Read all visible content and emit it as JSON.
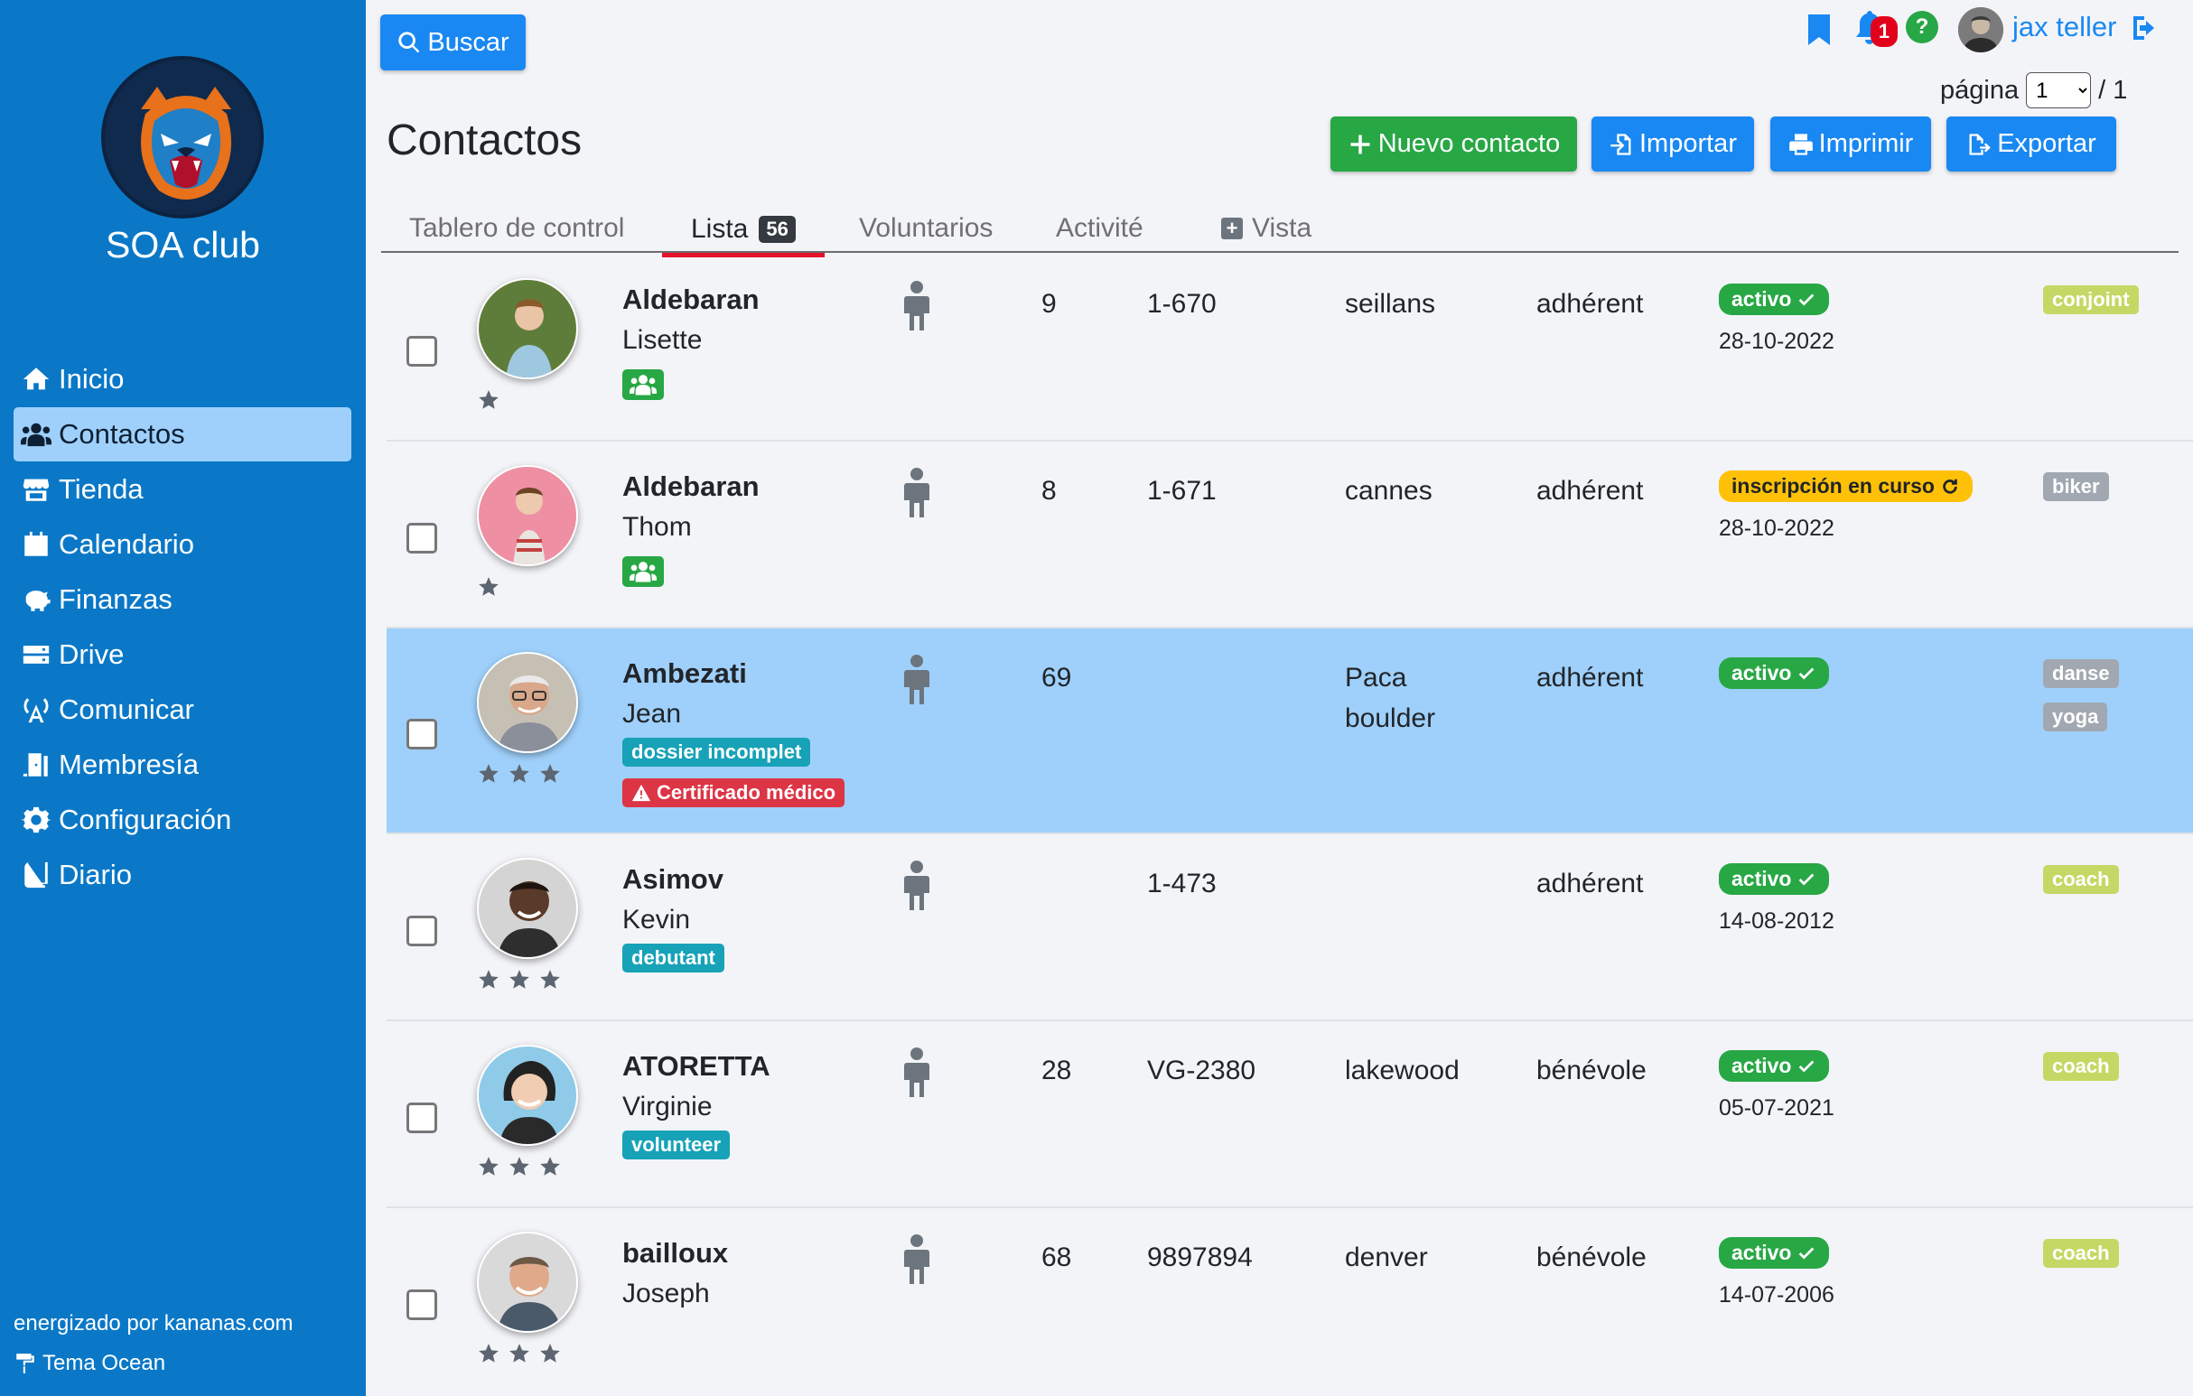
{
  "sidebar": {
    "club_name": "SOA club",
    "nav": [
      {
        "label": "Inicio",
        "icon": "home-icon"
      },
      {
        "label": "Contactos",
        "icon": "users-icon"
      },
      {
        "label": "Tienda",
        "icon": "store-icon"
      },
      {
        "label": "Calendario",
        "icon": "calendar-icon"
      },
      {
        "label": "Finanzas",
        "icon": "piggy-bank-icon"
      },
      {
        "label": "Drive",
        "icon": "drive-icon"
      },
      {
        "label": "Comunicar",
        "icon": "broadcast-icon"
      },
      {
        "label": "Membresía",
        "icon": "door-icon"
      },
      {
        "label": "Configuración",
        "icon": "gear-icon"
      },
      {
        "label": "Diario",
        "icon": "book-icon"
      }
    ],
    "powered_by": "energizado por kananas.com",
    "theme": "Tema Ocean"
  },
  "header": {
    "search_label": "Buscar",
    "notification_count": "1",
    "help_label": "?",
    "user_name": "jax teller",
    "page_label": "página",
    "page_value": "1",
    "page_total": "/ 1"
  },
  "page": {
    "title": "Contactos",
    "actions": {
      "new_contact": "Nuevo contacto",
      "import": "Importar",
      "print": "Imprimir",
      "export": "Exportar"
    }
  },
  "tabs": [
    {
      "label": "Tablero de control"
    },
    {
      "label": "Lista",
      "count": "56"
    },
    {
      "label": "Voluntarios"
    },
    {
      "label": "Activité"
    },
    {
      "label": "Vista"
    }
  ],
  "contacts": [
    {
      "last": "Aldebaran",
      "first": "Lisette",
      "age": "9",
      "code": "1-670",
      "city": "seillans",
      "city2": "",
      "role": "adhérent",
      "status": "activo",
      "date": "28-10-2022",
      "labels": [
        "conjoint"
      ],
      "stars": 1
    },
    {
      "last": "Aldebaran",
      "first": "Thom",
      "age": "8",
      "code": "1-671",
      "city": "cannes",
      "city2": "",
      "role": "adhérent",
      "status": "inscripción en curso",
      "date": "28-10-2022",
      "labels": [
        "biker"
      ],
      "stars": 1
    },
    {
      "last": "Ambezati",
      "first": "Jean",
      "age": "69",
      "code": "",
      "city": "Paca",
      "city2": "boulder",
      "role": "adhérent",
      "status": "activo",
      "date": "",
      "labels": [
        "danse",
        "yoga"
      ],
      "tags": [
        "dossier incomplet",
        "Certificado médico"
      ],
      "stars": 3
    },
    {
      "last": "Asimov",
      "first": "Kevin",
      "age": "",
      "code": "1-473",
      "city": "",
      "city2": "",
      "role": "adhérent",
      "status": "activo",
      "date": "14-08-2012",
      "labels": [
        "coach"
      ],
      "tags": [
        "debutant"
      ],
      "stars": 3
    },
    {
      "last": "ATORETTA",
      "first": "Virginie",
      "age": "28",
      "code": "VG-2380",
      "city": "lakewood",
      "city2": "",
      "role": "bénévole",
      "status": "activo",
      "date": "05-07-2021",
      "labels": [
        "coach"
      ],
      "tags": [
        "volunteer"
      ],
      "stars": 3
    },
    {
      "last": "bailloux",
      "first": "Joseph",
      "age": "68",
      "code": "9897894",
      "city": "denver",
      "city2": "",
      "role": "bénévole",
      "status": "activo",
      "date": "14-07-2006",
      "labels": [
        "coach"
      ],
      "stars": 3
    }
  ],
  "colors": {
    "sidebar": "#0a78c7",
    "active_nav": "#9fd0fb",
    "primary": "#1a88f2",
    "success": "#28a745",
    "warning": "#ffc107",
    "danger": "#dc3545",
    "info": "#17a2b8",
    "label_olive": "#c5d865",
    "label_gray": "#a1a8b1",
    "tab_underline": "#e5122b"
  }
}
